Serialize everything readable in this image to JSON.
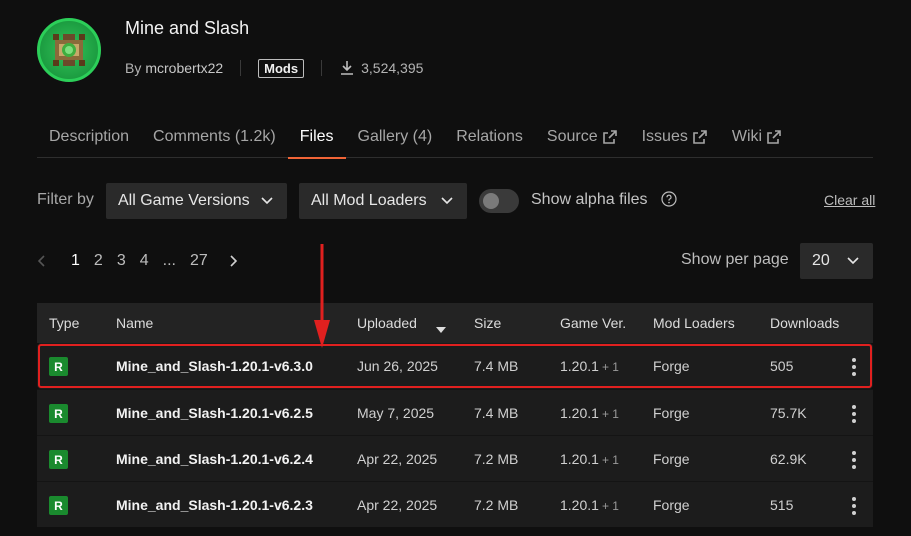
{
  "project": {
    "title": "Mine and Slash",
    "by_label": "By",
    "author": "mcrobertx22",
    "category_badge": "Mods",
    "downloads": "3,524,395"
  },
  "tabs": [
    {
      "label": "Description",
      "external": false
    },
    {
      "label": "Comments (1.2k)",
      "external": false
    },
    {
      "label": "Files",
      "external": false,
      "active": true
    },
    {
      "label": "Gallery (4)",
      "external": false
    },
    {
      "label": "Relations",
      "external": false
    },
    {
      "label": "Source",
      "external": true
    },
    {
      "label": "Issues",
      "external": true
    },
    {
      "label": "Wiki",
      "external": true
    }
  ],
  "filters": {
    "label": "Filter by",
    "game_versions": "All Game Versions",
    "mod_loaders": "All Mod Loaders",
    "alpha_label": "Show alpha files",
    "alpha_enabled": false,
    "clear_all": "Clear all"
  },
  "pagination": {
    "pages": [
      "1",
      "2",
      "3",
      "4",
      "...",
      "27"
    ],
    "current": "1",
    "per_page_label": "Show per page",
    "per_page": "20"
  },
  "table": {
    "headers": {
      "type": "Type",
      "name": "Name",
      "uploaded": "Uploaded",
      "size": "Size",
      "game_ver": "Game Ver.",
      "mod_loaders": "Mod Loaders",
      "downloads": "Downloads"
    },
    "rows": [
      {
        "type": "R",
        "name": "Mine_and_Slash-1.20.1-v6.3.0",
        "uploaded": "Jun 26, 2025",
        "size": "7.4 MB",
        "game_ver": "1.20.1",
        "game_ver_more": "+ 1",
        "loader": "Forge",
        "downloads": "505",
        "highlighted": true
      },
      {
        "type": "R",
        "name": "Mine_and_Slash-1.20.1-v6.2.5",
        "uploaded": "May 7, 2025",
        "size": "7.4 MB",
        "game_ver": "1.20.1",
        "game_ver_more": "+ 1",
        "loader": "Forge",
        "downloads": "75.7K"
      },
      {
        "type": "R",
        "name": "Mine_and_Slash-1.20.1-v6.2.4",
        "uploaded": "Apr 22, 2025",
        "size": "7.2 MB",
        "game_ver": "1.20.1",
        "game_ver_more": "+ 1",
        "loader": "Forge",
        "downloads": "62.9K"
      },
      {
        "type": "R",
        "name": "Mine_and_Slash-1.20.1-v6.2.3",
        "uploaded": "Apr 22, 2025",
        "size": "7.2 MB",
        "game_ver": "1.20.1",
        "game_ver_more": "+ 1",
        "loader": "Forge",
        "downloads": "515"
      }
    ]
  },
  "colors": {
    "accent": "#f16436",
    "release_badge": "#1a8a2e",
    "highlight": "#e0201f"
  }
}
